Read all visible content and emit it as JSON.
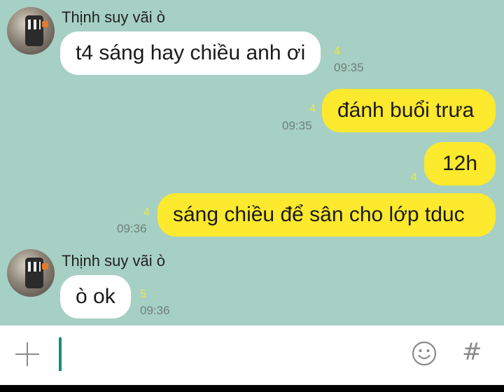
{
  "messages": [
    {
      "sender": "Thịnh suy vãi ò",
      "text": "t4 sáng hay chiều anh ơi",
      "count": "4",
      "time": "09:35"
    },
    {
      "text": "đánh buổi trưa",
      "count": "4",
      "time": "09:35"
    },
    {
      "text": "12h",
      "count": "4"
    },
    {
      "text": "sáng chiều để sân cho lớp tduc",
      "count": "4",
      "time": "09:36"
    },
    {
      "sender": "Thịnh suy vãi ò",
      "text": "ò ok",
      "count": "5",
      "time": "09:36"
    }
  ],
  "composer": {
    "hash_label": "#"
  },
  "colors": {
    "background": "#a6d0c3",
    "incoming_bubble": "#ffffff",
    "outgoing_bubble": "#fde92d",
    "count": "#f2e93a",
    "caret": "#1a8a7a"
  },
  "icons": {
    "attach": "plus-icon",
    "emoji": "smiley-icon",
    "tag": "hash-icon"
  }
}
